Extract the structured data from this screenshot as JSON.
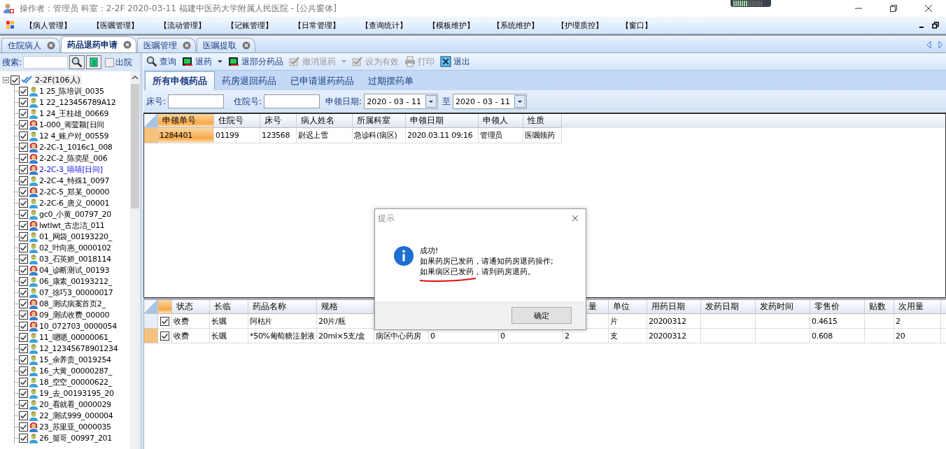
{
  "window": {
    "title": "操作者：管理员  科室：2-2F  2020-03-11  福建中医药大学附属人民医院 - [公共窗体]"
  },
  "menu": [
    "【病人管理】",
    "【医嘱管理】",
    "【流动管理】",
    "【记账管理】",
    "【日常管理】",
    "【查询统计】",
    "【模板维护】",
    "【系统维护】",
    "【护理质控】",
    "【窗口】"
  ],
  "tabs": [
    {
      "label": "住院病人",
      "selected": false
    },
    {
      "label": "药品退药申请",
      "selected": true
    },
    {
      "label": "医嘱管理",
      "selected": false
    },
    {
      "label": "医嘱提取",
      "selected": false
    }
  ],
  "sidebar": {
    "search_label": "搜索:",
    "discharged": {
      "label": "出院",
      "checked": false
    },
    "tree": {
      "label": "2-2F(106人)",
      "checked": true,
      "expanded": true,
      "children": [
        {
          "label": "1  25_陈培训_0035",
          "kind": "male",
          "checked": true,
          "selected": false
        },
        {
          "label": "1 22_123456789A12",
          "kind": "male",
          "checked": true,
          "selected": false
        },
        {
          "label": "1 24_王桂雄_00669",
          "kind": "male",
          "checked": true,
          "selected": false
        },
        {
          "label": "1-000_蒋莹颖[日间",
          "kind": "female",
          "checked": true,
          "selected": false
        },
        {
          "label": "12 4_账户对_00559",
          "kind": "male",
          "checked": true,
          "selected": false
        },
        {
          "label": "2-2C-1_1016c1_008",
          "kind": "female",
          "checked": true,
          "selected": false
        },
        {
          "label": "2-2C-2_陈奕星_006",
          "kind": "female",
          "checked": true,
          "selected": false
        },
        {
          "label": "2-2C-3_嘻嘻[日间]",
          "kind": "female",
          "checked": true,
          "selected": true
        },
        {
          "label": "2-2C-4_特殊1_0097",
          "kind": "male",
          "checked": true,
          "selected": false
        },
        {
          "label": "2-2C-5_郑某_00000",
          "kind": "female",
          "checked": true,
          "selected": false
        },
        {
          "label": "2-2C-6_唐义_00001",
          "kind": "male",
          "checked": true,
          "selected": false
        },
        {
          "label": "gc0_小黄_00797_20",
          "kind": "male",
          "checked": true,
          "selected": false
        },
        {
          "label": "lwtlwt_古忠洁_011",
          "kind": "female",
          "checked": true,
          "selected": false
        },
        {
          "label": "01_网袋_00193220_",
          "kind": "male",
          "checked": true,
          "selected": false
        },
        {
          "label": "02_叶向惠_0000102",
          "kind": "male",
          "checked": true,
          "selected": false
        },
        {
          "label": "03_石英娇_0018114",
          "kind": "male",
          "checked": true,
          "selected": false
        },
        {
          "label": "04_诊断测试_00193",
          "kind": "female",
          "checked": true,
          "selected": false
        },
        {
          "label": "06_康素_00193212_",
          "kind": "male",
          "checked": true,
          "selected": false
        },
        {
          "label": "07_徐巧3_00000017",
          "kind": "male",
          "checked": true,
          "selected": false
        },
        {
          "label": "08_测试病案首页2_",
          "kind": "female",
          "checked": true,
          "selected": false
        },
        {
          "label": "09_测试收费_00000",
          "kind": "female",
          "checked": true,
          "selected": false
        },
        {
          "label": "10_072703_0000054",
          "kind": "female",
          "checked": true,
          "selected": false
        },
        {
          "label": "11_嗯嗯_00000061_",
          "kind": "male",
          "checked": true,
          "selected": false
        },
        {
          "label": "12_12345678901234",
          "kind": "male",
          "checked": true,
          "selected": false
        },
        {
          "label": "15_余养贵_0019254",
          "kind": "male",
          "checked": true,
          "selected": false
        },
        {
          "label": "16_大黄_00000287_",
          "kind": "male",
          "checked": true,
          "selected": false
        },
        {
          "label": "18_空空_00000622_",
          "kind": "male",
          "checked": true,
          "selected": false
        },
        {
          "label": "19_去_00193195_20",
          "kind": "male",
          "checked": true,
          "selected": false
        },
        {
          "label": "20_看就看_0000029",
          "kind": "male",
          "checked": true,
          "selected": false
        },
        {
          "label": "22_测试999_000004",
          "kind": "male",
          "checked": true,
          "selected": false
        },
        {
          "label": "23_苏里亚_0000035",
          "kind": "female",
          "checked": true,
          "selected": false
        },
        {
          "label": "26_挺哥_00997_201",
          "kind": "male",
          "checked": true,
          "selected": false
        }
      ]
    }
  },
  "toolbar": [
    {
      "label": "查询",
      "kind": "search",
      "dropdown": false,
      "disabled": false
    },
    {
      "label": "退药",
      "kind": "box",
      "dropdown": true,
      "disabled": false
    },
    {
      "label": "退部分药品",
      "kind": "box",
      "dropdown": false,
      "disabled": false
    },
    {
      "label": "撤消退药",
      "kind": "tick",
      "dropdown": true,
      "disabled": true
    },
    {
      "label": "设为有效",
      "kind": "tick",
      "dropdown": false,
      "disabled": true
    },
    {
      "label": "打印",
      "kind": "printer",
      "dropdown": false,
      "disabled": true
    },
    {
      "label": "退出",
      "kind": "exit",
      "dropdown": false,
      "disabled": false
    }
  ],
  "subtabs": [
    {
      "label": "所有申领药品",
      "selected": true
    },
    {
      "label": "药房退回药品",
      "selected": false
    },
    {
      "label": "已申请退药药品",
      "selected": false
    },
    {
      "label": "过期摆药单",
      "selected": false
    }
  ],
  "filters": {
    "bed_label": "床号:",
    "admission_label": "住院号:",
    "date_label": "申领日期:",
    "date_from": "2020 - 03 - 11",
    "to_label": "至",
    "date_to": "2020 - 03 - 11"
  },
  "requests_table": {
    "columns": [
      "申领单号",
      "住院号",
      "床号",
      "病人姓名",
      "所属科室",
      "申领日期",
      "申领人",
      "性质"
    ],
    "rows": [
      {
        "selected": true,
        "cells": [
          "1284401",
          "01199",
          "123568",
          "尉迟上雪",
          "急诊科(病区)",
          "2020.03.11 09:16",
          "管理员",
          "医嘱领药"
        ]
      }
    ]
  },
  "items_table": {
    "columns": [
      "状态",
      "长临",
      "药品名称",
      "规格",
      null,
      null,
      null,
      "量",
      "单位",
      "用药日期",
      "发药日期",
      "发药时间",
      "零售价",
      "贴数",
      "次用量"
    ],
    "rows": [
      {
        "selected": false,
        "checked": true,
        "cells": [
          "收费",
          "长嘱",
          "阿枯片",
          "20片/瓶",
          null,
          null,
          null,
          null,
          "片",
          "20200312",
          null,
          null,
          "0.4615",
          null,
          "2"
        ]
      },
      {
        "selected": true,
        "checked": true,
        "cells": [
          "收费",
          "长嘱",
          "*50%葡萄糖注射液",
          "20ml×5支/盒",
          "病区中心药房",
          "0",
          "0",
          "2",
          "支",
          "20200312",
          null,
          null,
          "0.608",
          null,
          "20"
        ]
      }
    ]
  },
  "dialog": {
    "title": "提示",
    "lines": [
      "成功!",
      "如果药房已发药，请通知药房退药操作;",
      "如果病区已发药，请到药房退药。"
    ],
    "button": "确定"
  }
}
